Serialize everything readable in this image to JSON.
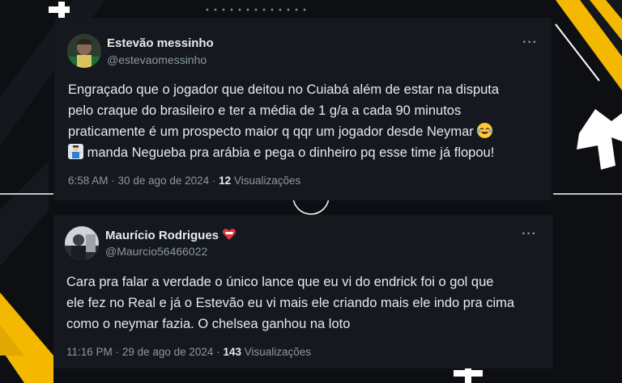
{
  "tweets": [
    {
      "name": "Estevão messinho",
      "handle": "@estevaomessinho",
      "more": "···",
      "lines": [
        "Engraçado que o jogador que deitou no Cuiabá além de estar na disputa",
        "pelo craque do brasileiro e ter a média de 1 g/a a cada 90 minutos",
        "praticamente é um prospecto maior q qqr um jogador desde Neymar",
        "manda Negueba pra arábia e pega o dinheiro pq esse time já flopou!"
      ],
      "emojis": [
        "laughing-tears-emoji",
        "man-shrugging-emoji"
      ],
      "time": "6:58 AM",
      "date": "30 de ago de 2024",
      "views_count": "12",
      "views_label": "Visualizações"
    },
    {
      "name": "Maurício Rodrigues",
      "handle": "@Maurcio56466022",
      "more": "···",
      "lines": [
        "Cara pra falar a verdade o único lance que eu vi do endrick foi o gol que",
        "ele fez no Real e já o Estevão eu vi mais ele criando mais ele indo pra cima",
        "como o neymar fazia. O chelsea ganhou na loto"
      ],
      "emojis": [
        "heart-shield-emoji"
      ],
      "time": "11:16 PM",
      "date": "29 de ago de 2024",
      "views_count": "143",
      "views_label": "Visualizações"
    }
  ],
  "colors": {
    "background": "#0d0f13",
    "card": "#15181f",
    "text": "#e7e9ea",
    "muted": "#8b98a5",
    "accent": "#f5b800"
  }
}
